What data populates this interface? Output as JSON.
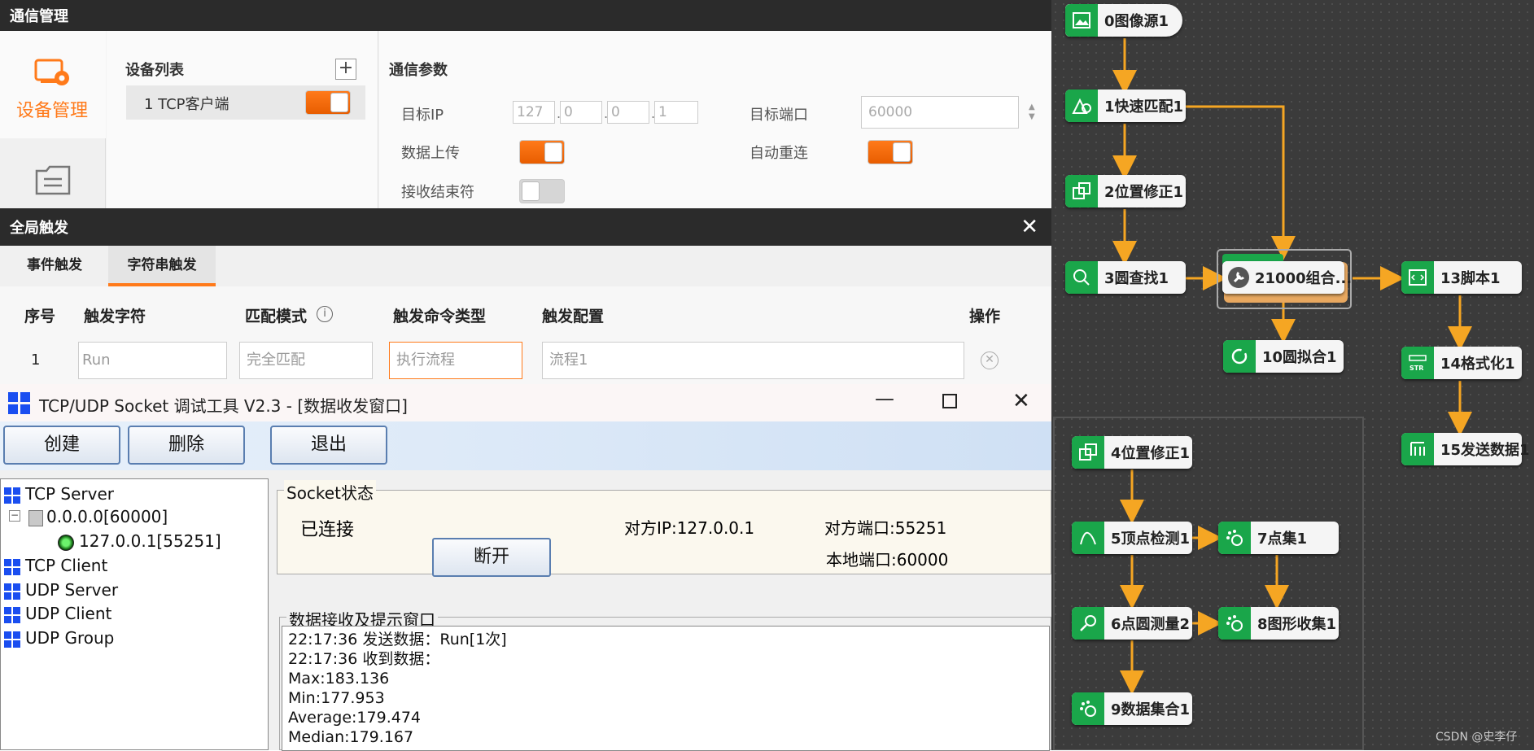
{
  "comm": {
    "title": "通信管理",
    "nav_device": "设备管理",
    "devlist_title": "设备列表",
    "device_item": "1 TCP客户端",
    "params_title": "通信参数",
    "target_ip_label": "目标IP",
    "ip": [
      "127",
      "0",
      "0",
      "1"
    ],
    "target_port_label": "目标端口",
    "target_port": "60000",
    "data_upload_label": "数据上传",
    "auto_reconnect_label": "自动重连",
    "recv_end_label": "接收结束符"
  },
  "trigger": {
    "title": "全局触发",
    "tabs": [
      "事件触发",
      "字符串触发"
    ],
    "headers": {
      "index": "序号",
      "char": "触发字符",
      "mode": "匹配模式",
      "cmd": "触发命令类型",
      "config": "触发配置",
      "op": "操作"
    },
    "row": {
      "index": "1",
      "char": "Run",
      "mode": "完全匹配",
      "cmd": "执行流程",
      "config": "流程1"
    }
  },
  "socket": {
    "title": "TCP/UDP Socket 调试工具 V2.3 - [数据收发窗口]",
    "buttons": {
      "create": "创建",
      "delete": "删除",
      "exit": "退出",
      "disconnect": "断开"
    },
    "tree": {
      "tcp_server": "TCP Server",
      "server_node": "0.0.0.0[60000]",
      "client_node": "127.0.0.1[55251]",
      "tcp_client": "TCP Client",
      "udp_server": "UDP Server",
      "udp_client": "UDP Client",
      "udp_group": "UDP Group"
    },
    "status_group": "Socket状态",
    "status": "已连接",
    "peer_ip": "对方IP:127.0.0.1",
    "peer_port": "对方端口:55251",
    "local_port": "本地端口:60000",
    "log_group": "数据接收及提示窗口",
    "log": [
      "22:17:36 发送数据：Run[1次]",
      "22:17:36 收到数据：",
      "Max:183.136",
      "Min:177.953",
      "Average:179.474",
      "Median:179.167"
    ]
  },
  "flow": {
    "nodes": {
      "n0": "0图像源1",
      "n1": "1快速匹配1",
      "n2": "2位置修正1",
      "n3": "3圆查找1",
      "n21000": "21000组合...",
      "n13": "13脚本1",
      "n10": "10圆拟合1",
      "n14": "14格式化1",
      "n15": "15发送数据1",
      "n4": "4位置修正1",
      "n5": "5顶点检测1",
      "n7": "7点集1",
      "n6": "6点圆测量2",
      "n8": "8图形收集1",
      "n9": "9数据集合1"
    },
    "watermark": "CSDN @史李仔",
    "accent": "#f5a623",
    "node_icon_color": "#1aa64a"
  }
}
